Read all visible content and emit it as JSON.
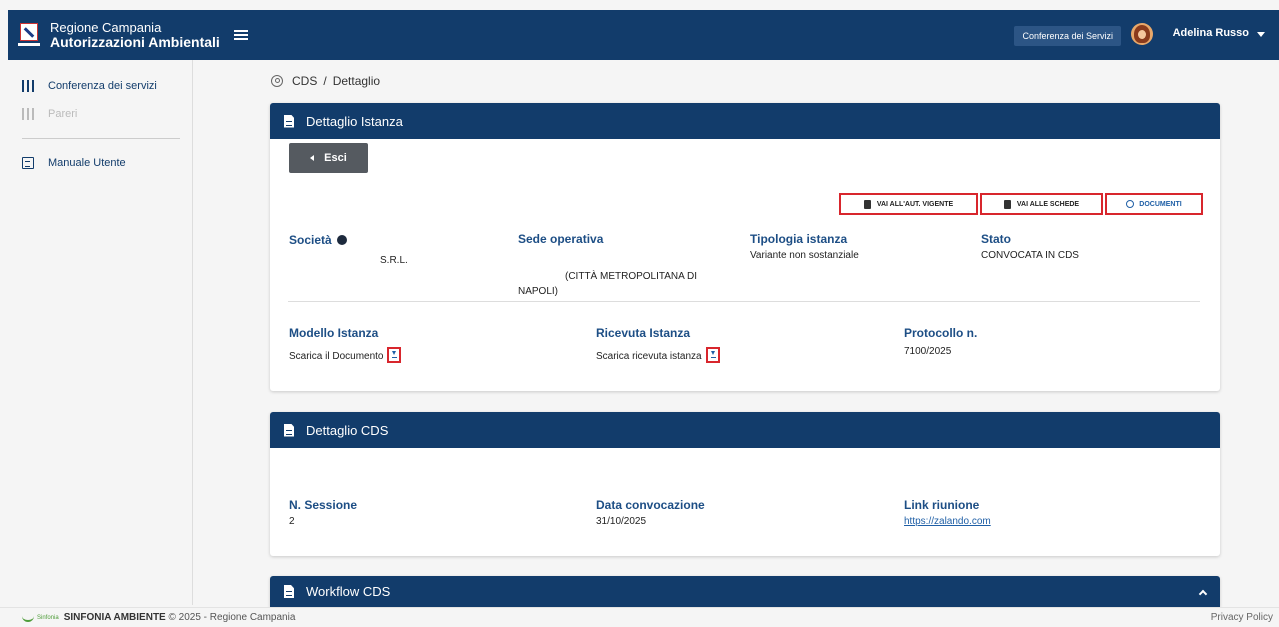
{
  "header": {
    "brand_line1": "Regione Campania",
    "brand_line2": "Autorizzazioni Ambientali",
    "conf_button": "Conferenza dei Servizi",
    "user_name": "Adelina Russo",
    "color": "#123c6b"
  },
  "sidebar": {
    "items": [
      {
        "label": "Conferenza dei servizi",
        "icon": "books-icon"
      },
      {
        "label": "Pareri",
        "icon": "books-icon"
      },
      {
        "label": "Manuale Utente",
        "icon": "document-icon"
      }
    ]
  },
  "breadcrumb": {
    "root": "CDS",
    "sep": "/",
    "current": "Dettaglio"
  },
  "istanza": {
    "title": "Dettaglio Istanza",
    "exit_label": "Esci",
    "actions": {
      "aut": "VAI ALL'AUT. VIGENTE",
      "schede": "VAI ALLE SCHEDE",
      "documenti": "DOCUMENTI"
    },
    "societa_label": "Società",
    "societa_value": "S.R.L.",
    "sede_label": "Sede operativa",
    "sede_value1": "(CITTÀ METROPOLITANA DI",
    "sede_value2": "NAPOLI)",
    "tipologia_label": "Tipologia istanza",
    "tipologia_value": "Variante non sostanziale",
    "stato_label": "Stato",
    "stato_value": "CONVOCATA IN CDS",
    "modello_label": "Modello Istanza",
    "modello_value": "Scarica il Documento",
    "ricevuta_label": "Ricevuta Istanza",
    "ricevuta_value": "Scarica ricevuta istanza",
    "protocollo_label": "Protocollo n.",
    "protocollo_value": "7100/2025"
  },
  "cds": {
    "title": "Dettaglio CDS",
    "sessione_label": "N. Sessione",
    "sessione_value": "2",
    "data_label": "Data convocazione",
    "data_value": "31/10/2025",
    "link_label": "Link riunione",
    "link_value": "https://zalando.com"
  },
  "workflow": {
    "title": "Workflow CDS"
  },
  "footer": {
    "brand_small": "Sinfonia",
    "brand": "SINFONIA AMBIENTE",
    "copy": " © 2025 - Regione Campania",
    "privacy": "Privacy Policy"
  }
}
